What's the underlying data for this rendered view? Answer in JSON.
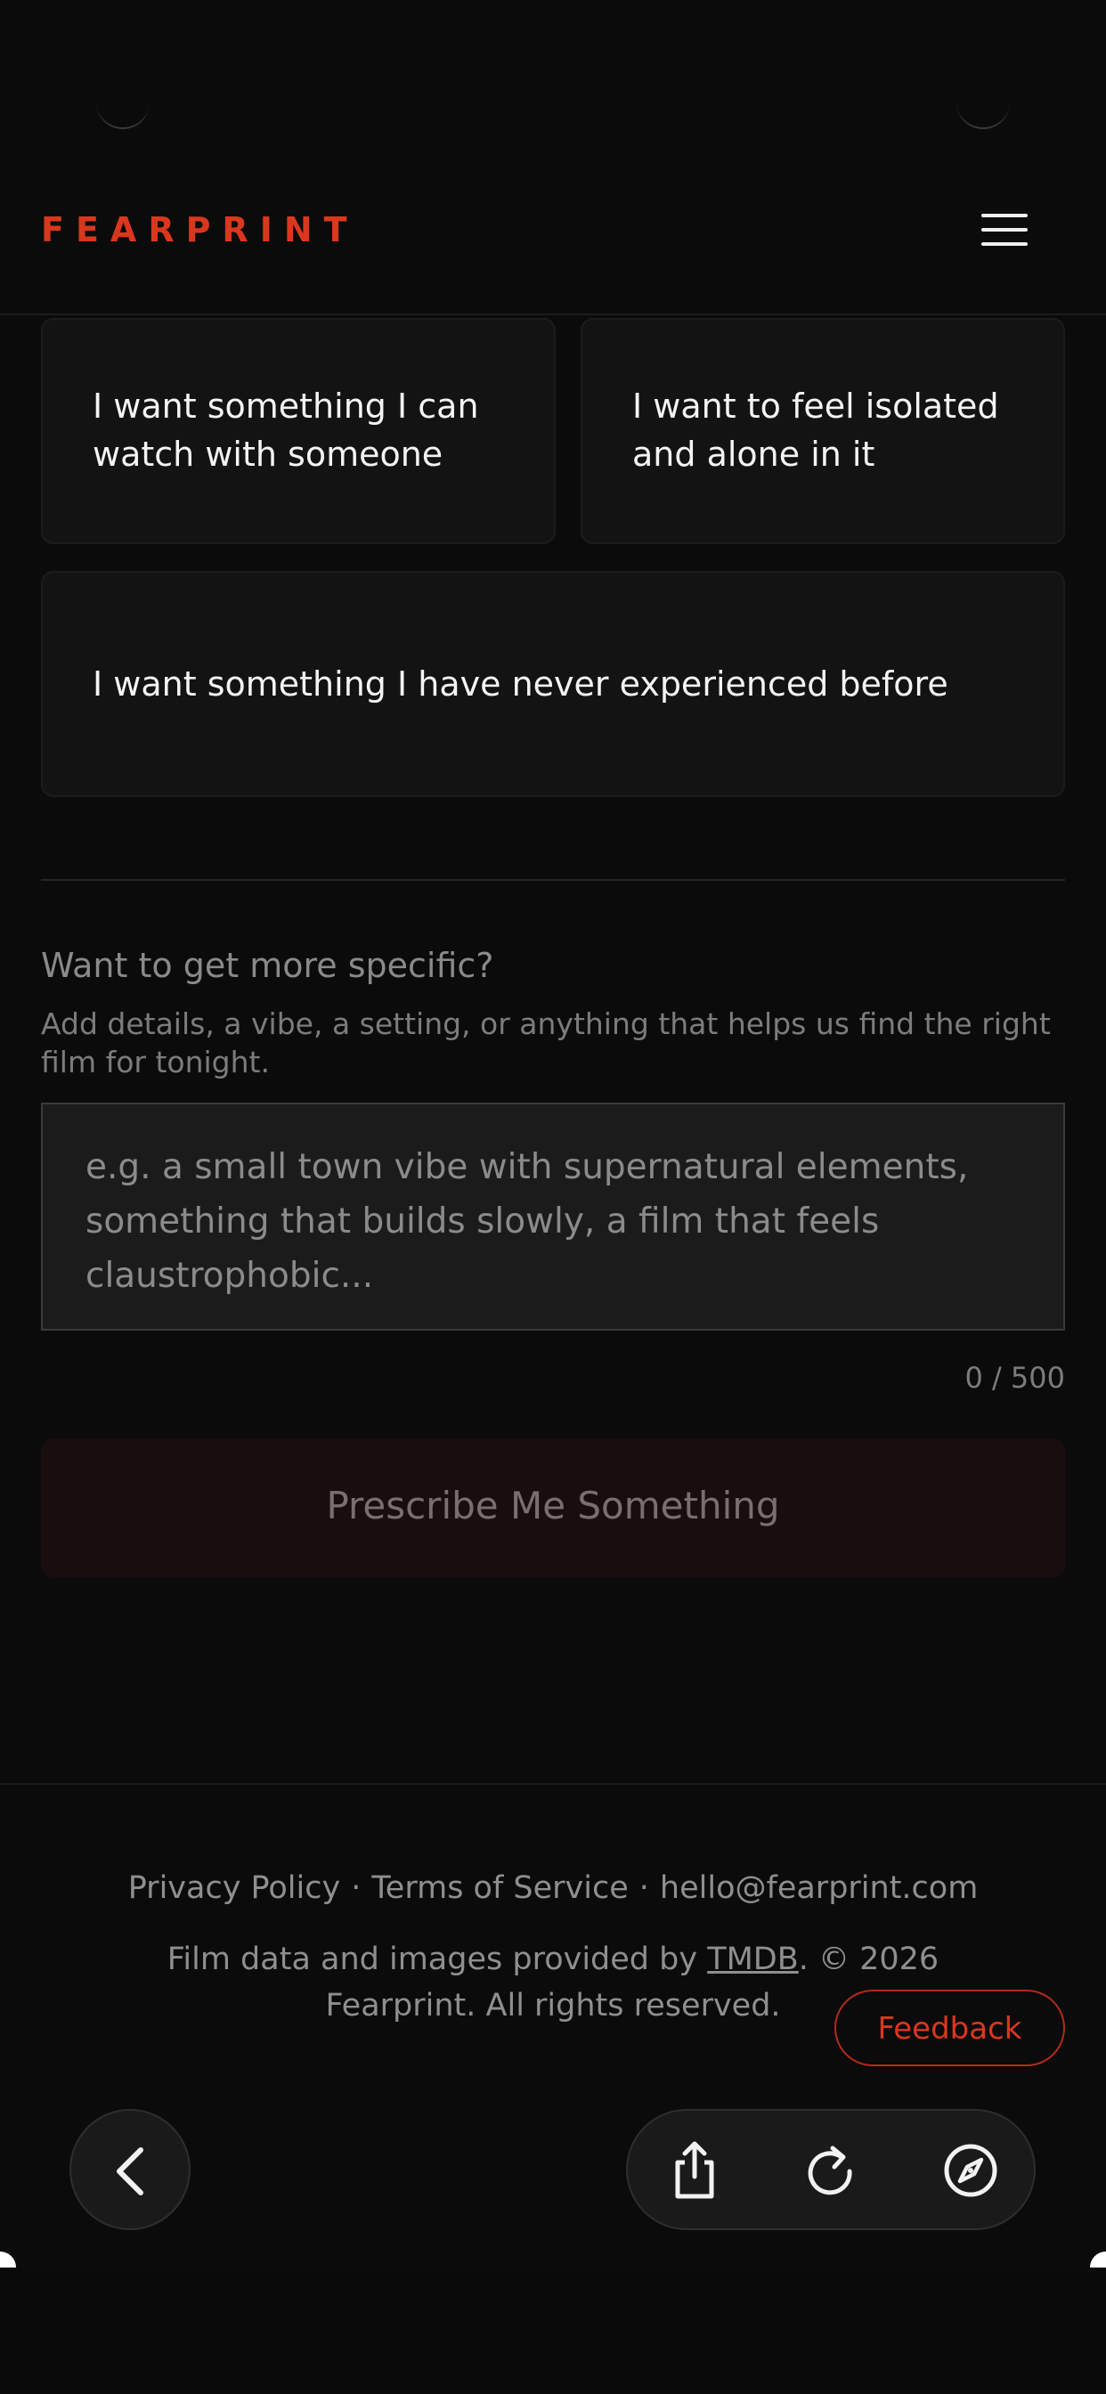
{
  "header": {
    "brand": "FEARPRINT"
  },
  "icons": {
    "menu": "hamburger-menu-icon",
    "back": "chevron-left-icon",
    "share": "share-icon",
    "reload": "reload-icon",
    "compass": "compass-icon"
  },
  "options": [
    {
      "label": "I want something I can watch with someone"
    },
    {
      "label": "I want to feel isolated and alone in it"
    },
    {
      "label": "I want something I have never experienced before"
    }
  ],
  "specific": {
    "title": "Want to get more specific?",
    "subtitle": "Add details, a vibe, a setting, or anything that helps us find the right film for tonight.",
    "placeholder": "e.g. a small town vibe with supernatural elements, something that builds slowly, a film that feels claustrophobic...",
    "value": "",
    "counter": "0 / 500"
  },
  "cta": {
    "label": "Prescribe Me Something"
  },
  "footer": {
    "privacy": "Privacy Policy",
    "terms": "Terms of Service",
    "email": "hello@fearprint.com",
    "separator": "·",
    "credits_prefix": "Film data and images provided by ",
    "tmdb": "TMDB",
    "credits_suffix": ". © 2026 Fearprint. All rights reserved."
  },
  "feedback": {
    "label": "Feedback"
  },
  "colors": {
    "accent": "#d9381e",
    "background": "#0b0b0b",
    "card": "#131313"
  }
}
